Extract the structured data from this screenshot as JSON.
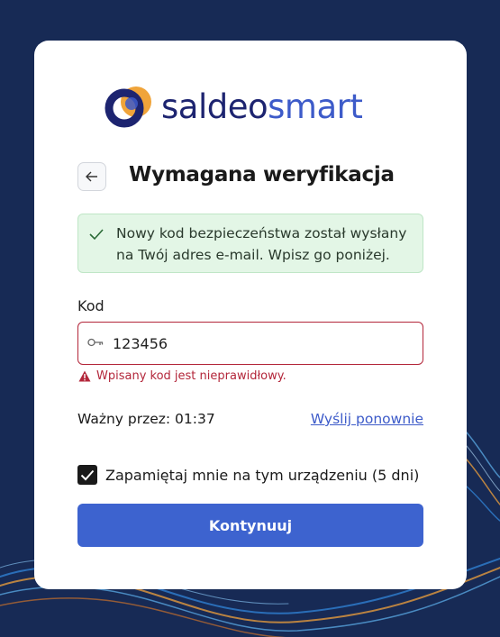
{
  "brand": {
    "name_part1": "saldeo",
    "name_part2": "smart",
    "primary_color": "#1d2470",
    "accent_color": "#3d5bc9",
    "orange": "#f0a43a"
  },
  "header": {
    "title": "Wymagana weryfikacja",
    "back_icon": "arrow-left-icon"
  },
  "alert": {
    "icon": "check-icon",
    "message": "Nowy kod bezpieczeństwa został wysłany na Twój adres e-mail. Wpisz go poniżej."
  },
  "form": {
    "code_label": "Kod",
    "code_value": "123456",
    "code_icon": "key-icon",
    "error_message": "Wpisany kod jest nieprawidłowy.",
    "timer_text": "Ważny przez: 01:37",
    "resend_label": "Wyślij ponownie",
    "remember_label": "Zapamiętaj mnie na tym urządzeniu (5 dni)",
    "remember_checked": true,
    "submit_label": "Kontynuuj"
  },
  "colors": {
    "background": "#172a55",
    "error": "#b3263a",
    "success_bg": "#e3f6e6",
    "button": "#3d63cf"
  }
}
